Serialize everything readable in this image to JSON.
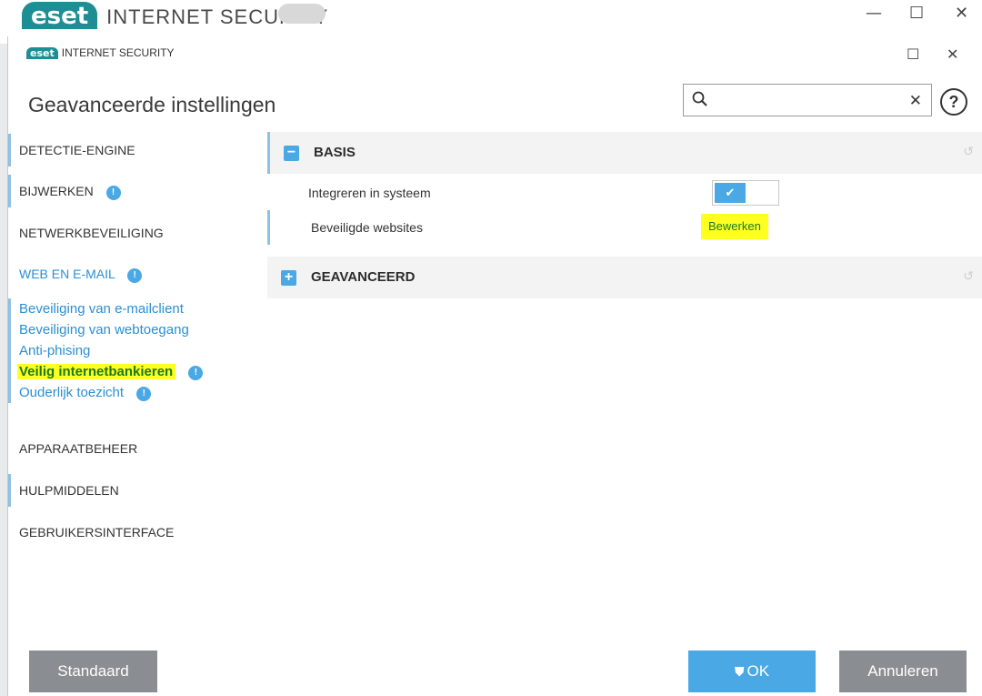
{
  "background_window": {
    "logo": "eset",
    "title": "INTERNET SECURITY",
    "minimize": "—",
    "maximize": "☐",
    "close": "✕"
  },
  "window": {
    "logo": "eset",
    "title": "INTERNET SECURITY",
    "maximize": "☐",
    "close": "✕"
  },
  "header": {
    "title": "Geavanceerde instellingen",
    "search_value": "",
    "clear": "✕",
    "help": "?"
  },
  "sidebar": {
    "items": [
      {
        "label": "DETECTIE-ENGINE",
        "badge": null
      },
      {
        "label": "BIJWERKEN",
        "badge": "!"
      },
      {
        "label": "NETWERKBEVEILIGING",
        "badge": null
      },
      {
        "label": "WEB EN E-MAIL",
        "badge": "!"
      },
      {
        "label": "APPARAATBEHEER",
        "badge": null
      },
      {
        "label": "HULPMIDDELEN",
        "badge": null
      },
      {
        "label": "GEBRUIKERSINTERFACE",
        "badge": null
      }
    ],
    "subitems": [
      {
        "label": "Beveiliging van e-mailclient"
      },
      {
        "label": "Beveiliging van webtoegang"
      },
      {
        "label": "Anti-phising"
      },
      {
        "label": "Veilig internetbankieren",
        "badge": "!"
      },
      {
        "label": "Ouderlijk toezicht",
        "badge": "!"
      }
    ]
  },
  "sections": {
    "basis": {
      "toggle_symbol": "−",
      "title": "BASIS",
      "undo": "↺",
      "rows": {
        "integrate_label": "Integreren in systeem",
        "integrate_check": "✔",
        "integrate_enabled": true,
        "websites_label": "Beveiligde websites",
        "websites_action": "Bewerken"
      }
    },
    "geavanceerd": {
      "toggle_symbol": "+",
      "title": "GEAVANCEERD",
      "undo": "↺"
    }
  },
  "footer": {
    "standard": "Standaard",
    "ok_icon": "⛊",
    "ok": "OK",
    "cancel": "Annuleren"
  },
  "colors": {
    "accent": "#4aa8e5",
    "highlight": "#ffff22",
    "brand": "#1d8f94",
    "button_gray": "#8a8e92"
  }
}
